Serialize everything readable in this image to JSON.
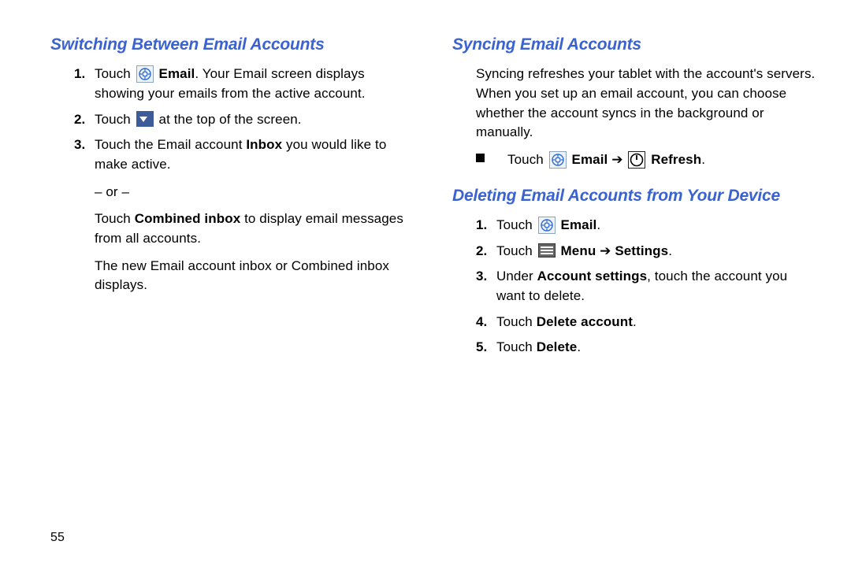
{
  "page_number": "55",
  "left": {
    "heading": "Switching Between Email Accounts",
    "items": [
      {
        "num": "1.",
        "pre": "Touch ",
        "bold_after_icon": "Email",
        "post": ". Your Email screen displays showing your emails from the active account."
      },
      {
        "num": "2.",
        "pre": "Touch ",
        "post": " at the top of the screen."
      },
      {
        "num": "3.",
        "pre": "Touch the Email account ",
        "bold_inline": "Inbox",
        "post": " you would like to make active.",
        "or": "– or –",
        "cont1_pre": "Touch ",
        "cont1_bold": "Combined inbox",
        "cont1_post": " to display email messages from all accounts.",
        "cont2": "The new Email account inbox or Combined inbox displays."
      }
    ]
  },
  "right": {
    "heading1": "Syncing Email Accounts",
    "intro": "Syncing refreshes your tablet with the account's servers. When you set up an email account, you can choose whether the account syncs in the background or manually.",
    "sync_bullet": {
      "pre": "Touch ",
      "bold1": "Email",
      "arrow": " ➔ ",
      "bold2": "Refresh",
      "post": "."
    },
    "heading2": "Deleting Email Accounts from Your Device",
    "del": [
      {
        "num": "1.",
        "pre": "Touch ",
        "bold_after_icon": "Email",
        "post": "."
      },
      {
        "num": "2.",
        "pre": "Touch ",
        "bold_after_icon": "Menu",
        "arrow": " ➔ ",
        "bold2": "Settings",
        "post": "."
      },
      {
        "num": "3.",
        "pre": "Under ",
        "bold_inline": "Account settings",
        "post": ", touch the account you want to delete."
      },
      {
        "num": "4.",
        "pre": "Touch ",
        "bold_inline": "Delete account",
        "post": "."
      },
      {
        "num": "5.",
        "pre": "Touch ",
        "bold_inline": "Delete",
        "post": "."
      }
    ]
  }
}
